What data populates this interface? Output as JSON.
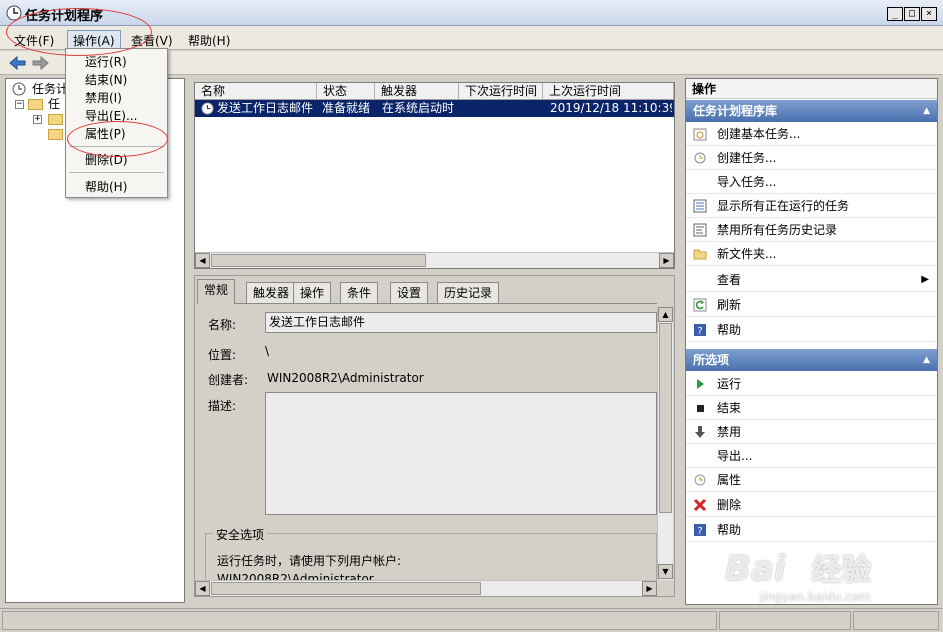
{
  "window": {
    "title": "任务计划程序",
    "min": "_",
    "max": "□",
    "close": "×"
  },
  "menubar": {
    "items": [
      "文件(F)",
      "操作(A)",
      "查看(V)",
      "帮助(H)"
    ]
  },
  "dropdown": {
    "items": [
      "运行(R)",
      "结束(N)",
      "禁用(I)",
      "导出(E)...",
      "属性(P)",
      "删除(D)",
      "帮助(H)"
    ]
  },
  "tree": {
    "root": "任务计",
    "child": "任"
  },
  "list": {
    "columns": [
      "名称",
      "状态",
      "触发器",
      "下次运行时间",
      "上次运行时间"
    ],
    "rows": [
      {
        "name": "发送工作日志邮件",
        "status": "准备就绪",
        "trigger": "在系统启动时",
        "next": "",
        "last": "2019/12/18 11:10:39"
      }
    ]
  },
  "detail": {
    "tabs": [
      "常规",
      "触发器",
      "操作",
      "条件",
      "设置",
      "历史记录"
    ],
    "name_label": "名称:",
    "name_value": "发送工作日志邮件",
    "location_label": "位置:",
    "location_value": "\\",
    "author_label": "创建者:",
    "author_value": "WIN2008R2\\Administrator",
    "desc_label": "描述:",
    "security_title": "安全选项",
    "security_text": "运行任务时，请使用下列用户帐户:",
    "security_account": "WIN2008R2\\Administrator"
  },
  "actions": {
    "title": "操作",
    "section1": "任务计划程序库",
    "items1": [
      "创建基本任务...",
      "创建任务...",
      "导入任务...",
      "显示所有正在运行的任务",
      "禁用所有任务历史记录",
      "新文件夹...",
      "查看",
      "刷新",
      "帮助"
    ],
    "section2": "所选项",
    "items2": [
      "运行",
      "结束",
      "禁用",
      "导出...",
      "属性",
      "删除",
      "帮助"
    ]
  },
  "watermark": {
    "brand": "Bai",
    "brand2": "经验",
    "url": "jingyan.baidu.com"
  }
}
